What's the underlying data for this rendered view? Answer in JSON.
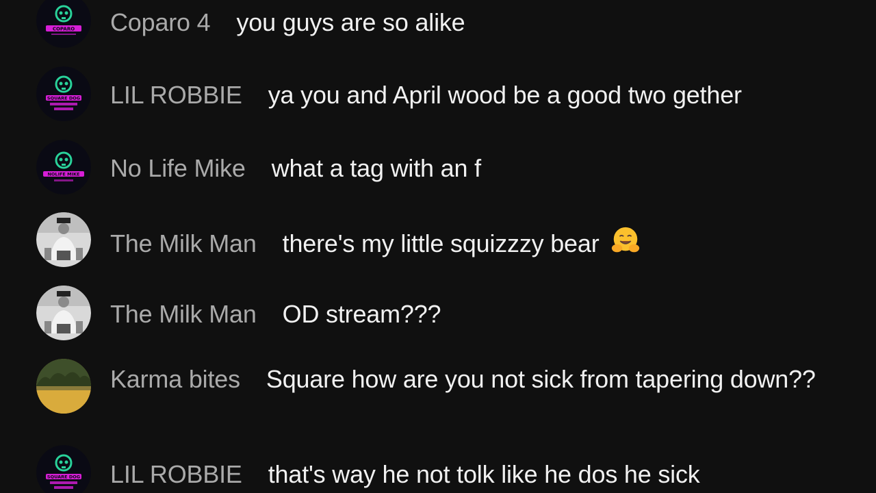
{
  "colors": {
    "background": "#101010",
    "author": "#aaaaaa",
    "message": "#f1f1f1",
    "skull_green": "#29d29a",
    "badge_magenta": "#d61ed6"
  },
  "messages": [
    {
      "author": "Coparo 4",
      "text": "you guys are so alike",
      "avatar": "skull-logo-icon",
      "badge": "COPARO"
    },
    {
      "author": "LIL ROBBIE",
      "text": "ya you and April wood be a good two gether",
      "avatar": "skull-logo-icon",
      "badge": "SQUARE DOG"
    },
    {
      "author": "No Life Mike",
      "text": "what a tag with an f",
      "avatar": "skull-logo-icon",
      "badge": "NOLIFE MIKE"
    },
    {
      "author": "The Milk Man",
      "text": "there's my little squizzzy bear",
      "avatar": "milkman-photo",
      "emoji": "hugging-face-emoji"
    },
    {
      "author": "The Milk Man",
      "text": "OD stream???",
      "avatar": "milkman-photo"
    },
    {
      "author": "Karma bites",
      "text": "Square how are you not sick from tapering down??",
      "avatar": "nature-photo"
    },
    {
      "author": "LIL ROBBIE",
      "text": "that's way he not tolk like he dos he sick",
      "avatar": "skull-logo-icon",
      "badge": "SQUARE DOG"
    }
  ]
}
